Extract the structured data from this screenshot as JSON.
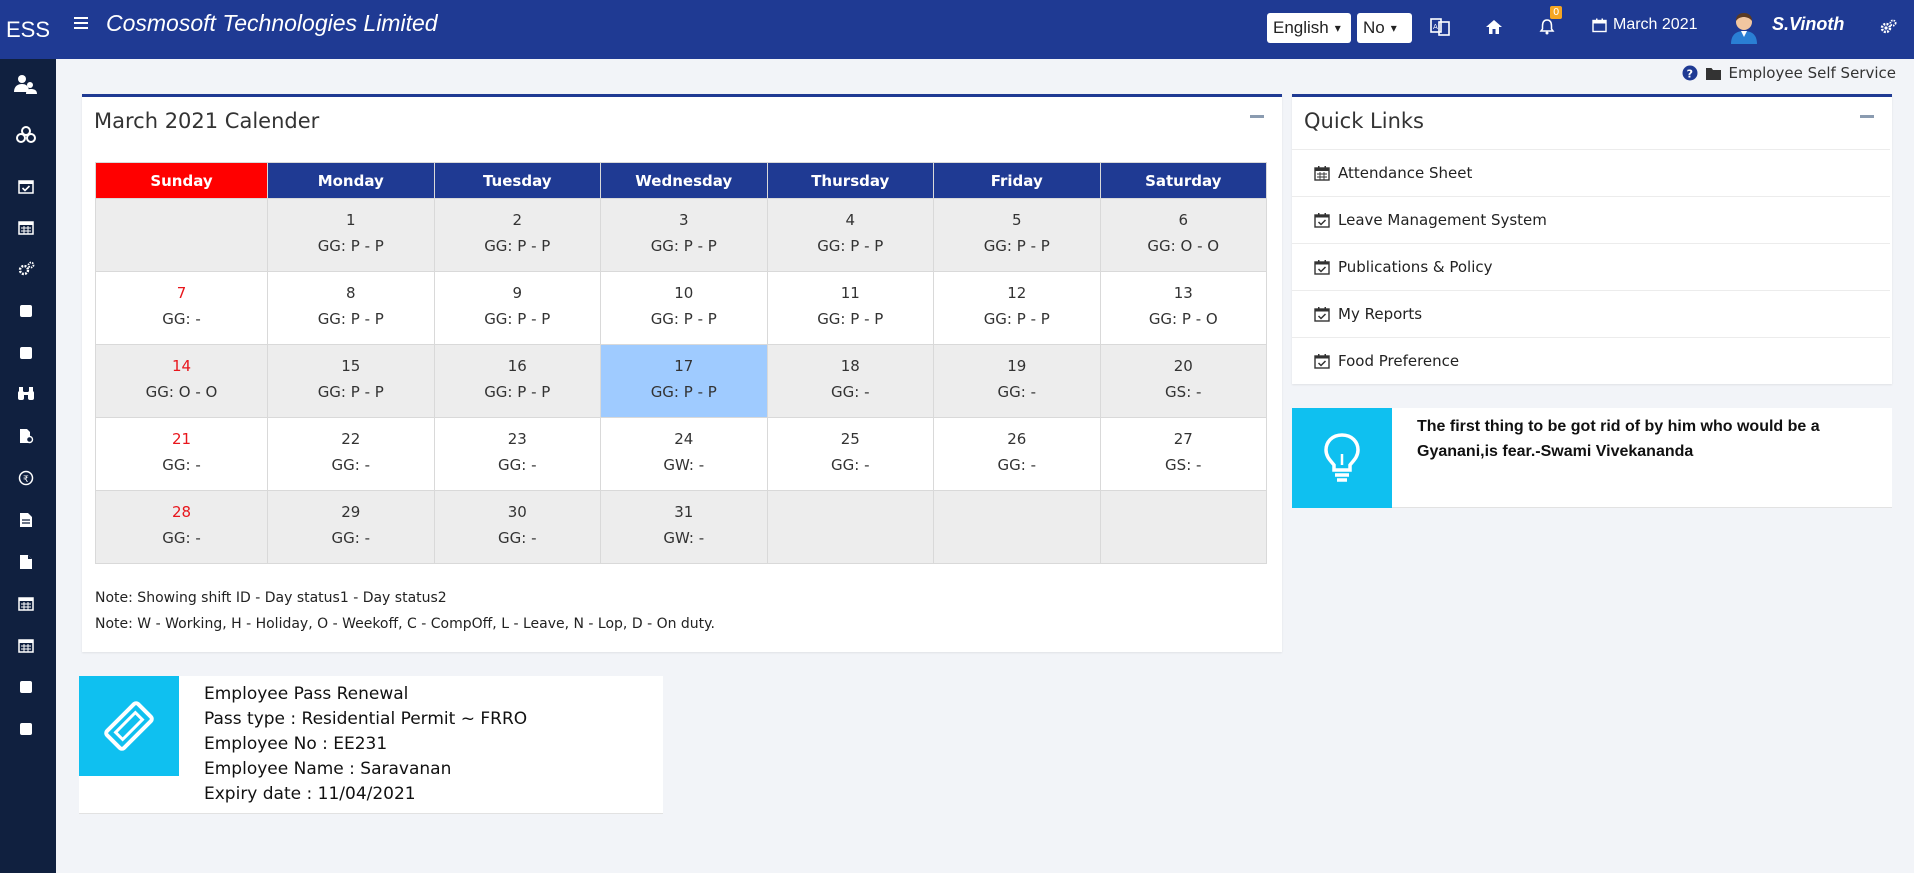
{
  "header": {
    "brand": "ESS",
    "company": "Cosmosoft Technologies Limited",
    "language": "English",
    "option": "No",
    "notification_count": "0",
    "date_label": "March 2021",
    "username": "S.Vinoth"
  },
  "breadcrumb": {
    "label": "Employee Self Service"
  },
  "calendar": {
    "title": "March 2021 Calender",
    "days": [
      "Sunday",
      "Monday",
      "Tuesday",
      "Wednesday",
      "Thursday",
      "Friday",
      "Saturday"
    ],
    "weeks": [
      [
        {
          "d": "",
          "s": ""
        },
        {
          "d": "1",
          "s": "GG: P - P"
        },
        {
          "d": "2",
          "s": "GG: P - P"
        },
        {
          "d": "3",
          "s": "GG: P - P"
        },
        {
          "d": "4",
          "s": "GG: P - P"
        },
        {
          "d": "5",
          "s": "GG: P - P"
        },
        {
          "d": "6",
          "s": "GG: O - O"
        }
      ],
      [
        {
          "d": "7",
          "s": "GG: -"
        },
        {
          "d": "8",
          "s": "GG: P - P"
        },
        {
          "d": "9",
          "s": "GG: P - P"
        },
        {
          "d": "10",
          "s": "GG: P - P"
        },
        {
          "d": "11",
          "s": "GG: P - P"
        },
        {
          "d": "12",
          "s": "GG: P - P"
        },
        {
          "d": "13",
          "s": "GG: P - O"
        }
      ],
      [
        {
          "d": "14",
          "s": "GG: O - O"
        },
        {
          "d": "15",
          "s": "GG: P - P"
        },
        {
          "d": "16",
          "s": "GG: P - P"
        },
        {
          "d": "17",
          "s": "GG: P - P"
        },
        {
          "d": "18",
          "s": "GG: -"
        },
        {
          "d": "19",
          "s": "GG: -"
        },
        {
          "d": "20",
          "s": "GS: -"
        }
      ],
      [
        {
          "d": "21",
          "s": "GG: -"
        },
        {
          "d": "22",
          "s": "GG: -"
        },
        {
          "d": "23",
          "s": "GG: -"
        },
        {
          "d": "24",
          "s": "GW: -"
        },
        {
          "d": "25",
          "s": "GG: -"
        },
        {
          "d": "26",
          "s": "GG: -"
        },
        {
          "d": "27",
          "s": "GS: -"
        }
      ],
      [
        {
          "d": "28",
          "s": "GG: -"
        },
        {
          "d": "29",
          "s": "GG: -"
        },
        {
          "d": "30",
          "s": "GG: -"
        },
        {
          "d": "31",
          "s": "GW: -"
        },
        {
          "d": "",
          "s": ""
        },
        {
          "d": "",
          "s": ""
        },
        {
          "d": "",
          "s": ""
        }
      ]
    ],
    "today": "17",
    "note1": "Note: Showing shift ID - Day status1 - Day status2",
    "note2": "Note: W - Working, H - Holiday, O - Weekoff, C - CompOff, L - Leave, N - Lop, D - On duty."
  },
  "quick_links": {
    "title": "Quick Links",
    "items": [
      {
        "label": "Attendance Sheet",
        "icon": "calendar-icon"
      },
      {
        "label": "Leave Management System",
        "icon": "calendar-check-icon"
      },
      {
        "label": "Publications & Policy",
        "icon": "calendar-check-icon"
      },
      {
        "label": "My Reports",
        "icon": "calendar-check-icon"
      },
      {
        "label": "Food Preference",
        "icon": "calendar-check-icon"
      }
    ]
  },
  "quote": {
    "text": "The first thing to be got rid of by him who would be a Gyanani,is fear.-Swami Vivekananda",
    "icon": "lightbulb-icon"
  },
  "pass": {
    "icon": "ticket-icon",
    "title": "Employee Pass Renewal",
    "type": "Pass type : Residential Permit ~ FRRO",
    "emp_no": "Employee No : EE231",
    "emp_name": "Employee Name : Saravanan",
    "expiry": "Expiry date : 11/04/2021"
  },
  "colors": {
    "primary": "#1f3a93",
    "sunday": "#ff0000",
    "today": "#9fcbff",
    "accent": "#0fc0f0"
  }
}
